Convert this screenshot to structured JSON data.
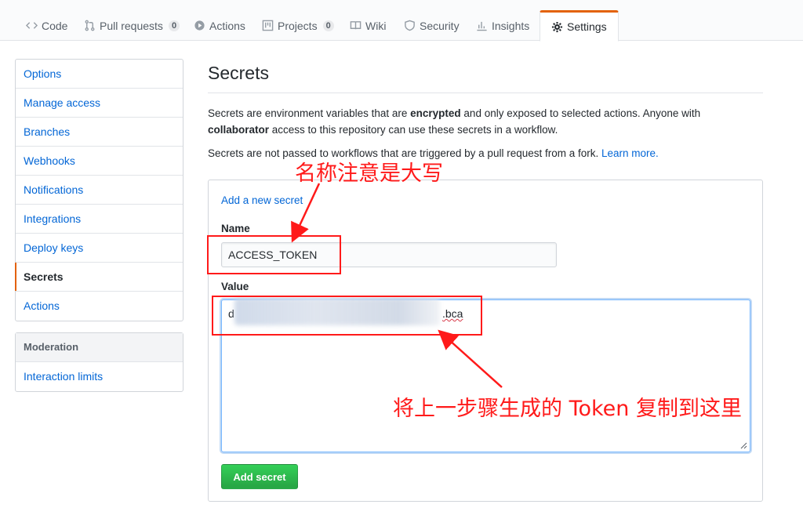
{
  "repo_nav": {
    "tabs": [
      {
        "label": "Code",
        "icon": "code-icon"
      },
      {
        "label": "Pull requests",
        "icon": "pull-request-icon",
        "count": "0"
      },
      {
        "label": "Actions",
        "icon": "play-icon"
      },
      {
        "label": "Projects",
        "icon": "project-icon",
        "count": "0"
      },
      {
        "label": "Wiki",
        "icon": "book-icon"
      },
      {
        "label": "Security",
        "icon": "shield-icon"
      },
      {
        "label": "Insights",
        "icon": "graph-icon"
      },
      {
        "label": "Settings",
        "icon": "gear-icon",
        "selected": true
      }
    ]
  },
  "sidebar": {
    "items": [
      "Options",
      "Manage access",
      "Branches",
      "Webhooks",
      "Notifications",
      "Integrations",
      "Deploy keys",
      "Secrets",
      "Actions"
    ],
    "selected": "Secrets",
    "moderation": {
      "heading": "Moderation",
      "items": [
        "Interaction limits"
      ]
    }
  },
  "main": {
    "title": "Secrets",
    "desc1_pre": "Secrets are environment variables that are ",
    "desc1_bold1": "encrypted",
    "desc1_mid": " and only exposed to selected actions. Anyone with ",
    "desc1_bold2": "collaborator",
    "desc1_post": " access to this repository can use these secrets in a workflow.",
    "desc2_pre": "Secrets are not passed to workflows that are triggered by a pull request from a fork. ",
    "desc2_link": "Learn more."
  },
  "form": {
    "heading_link": "Add a new secret",
    "name_label": "Name",
    "name_value": "ACCESS_TOKEN",
    "value_label": "Value",
    "value_prefix": "d",
    "value_suffix": ".bca",
    "submit_label": "Add secret"
  },
  "annotations": {
    "name_note": "名称注意是大写",
    "value_note": "将上一步骤生成的 Token 复制到这里"
  },
  "colors": {
    "accent_orange": "#e36209",
    "link_blue": "#0366d6",
    "button_green": "#28a745",
    "annotation_red": "#ff1a1a"
  }
}
